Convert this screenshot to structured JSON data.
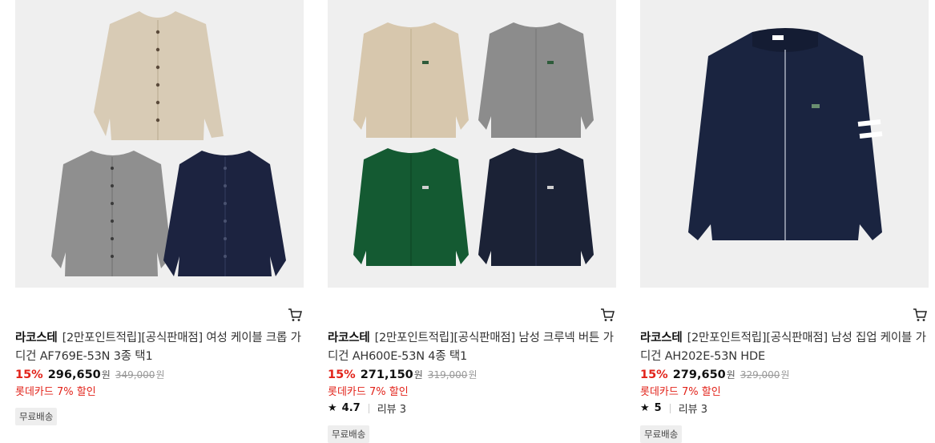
{
  "products": [
    {
      "brand": "라코스테",
      "name": "[2만포인트적립][공식판매점] 여성 케이블 크롭 가디건 AF769E-53N 3종 택1",
      "discount": "15%",
      "price": "296,650",
      "currency": "원",
      "original_price": "349,000",
      "card_promo": "롯데카드 7% 할인",
      "badge": "무료배송",
      "colors": [
        "#d8cbb5",
        "#8f8f8f",
        "#1c2340"
      ]
    },
    {
      "brand": "라코스테",
      "name": "[2만포인트적립][공식판매점] 남성 크루넥 버튼 가디건 AH600E-53N 4종 택1",
      "discount": "15%",
      "price": "271,150",
      "currency": "원",
      "original_price": "319,000",
      "card_promo": "롯데카드 7% 할인",
      "rating": "4.7",
      "reviews": "리뷰 3",
      "badge": "무료배송",
      "colors": [
        "#d7c7ad",
        "#8c8c8c",
        "#145a32",
        "#1b2236"
      ]
    },
    {
      "brand": "라코스테",
      "name": "[2만포인트적립][공식판매점] 남성 집업 케이블 가디건 AH202E-53N HDE",
      "discount": "15%",
      "price": "279,650",
      "currency": "원",
      "original_price": "329,000",
      "card_promo": "롯데카드 7% 할인",
      "rating": "5",
      "reviews": "리뷰 3",
      "badge": "무료배송",
      "colors": [
        "#1a2440",
        "#ffffff"
      ]
    }
  ],
  "icons": {
    "cart": "cart-icon",
    "star": "star-icon"
  },
  "accent_color": "#e2231a"
}
